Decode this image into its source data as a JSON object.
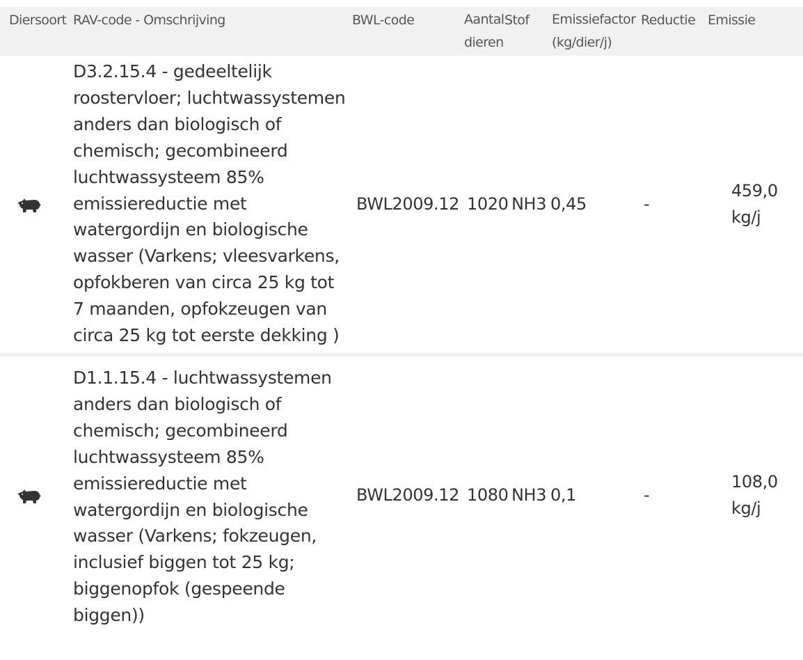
{
  "table": {
    "headers": {
      "diersoort": "Diersoort",
      "rav": "RAV-code - Omschrijving",
      "bwl": "BWL-code",
      "aantal": "Aantal dieren",
      "stof": "Stof",
      "factor": "Emissiefactor (kg/dier/j)",
      "reductie": "Reductie",
      "emissie": "Emissie"
    },
    "rows": [
      {
        "icon": "pig-icon",
        "rav": "D3.2.15.4 - gedeeltelijk roostervloer; luchtwassystemen anders dan biologisch of chemisch; gecombineerd luchtwassysteem 85% emissiereductie met watergordijn en biologische wasser (Varkens; vleesvarkens, opfokberen van circa 25 kg tot 7 maanden, opfokzeugen van circa 25 kg tot eerste dekking )",
        "bwl": "BWL2009.12",
        "aantal": "1020",
        "stof": "NH3",
        "factor": "0,45",
        "reductie": "-",
        "emissie": "459,0 kg/j"
      },
      {
        "icon": "pig-icon",
        "rav": "D1.1.15.4 - luchtwassystemen anders dan biologisch of chemisch; gecombineerd luchtwassysteem 85% emissiereductie met watergordijn en biologische wasser (Varkens; fokzeugen, inclusief biggen tot 25 kg; biggenopfok (gespeende biggen))",
        "bwl": "BWL2009.12",
        "aantal": "1080",
        "stof": "NH3",
        "factor": "0,1",
        "reductie": "-",
        "emissie": "108,0 kg/j"
      }
    ]
  }
}
